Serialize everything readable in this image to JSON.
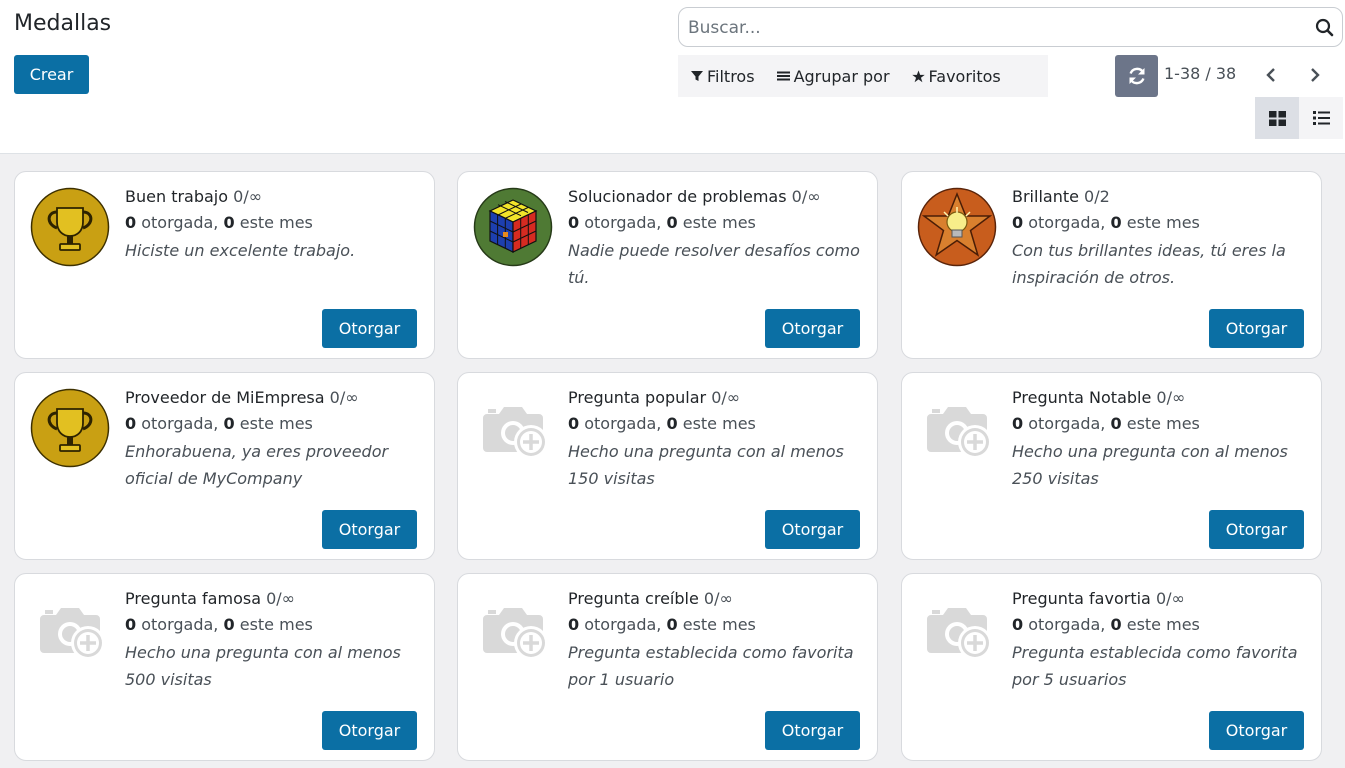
{
  "page": {
    "title": "Medallas",
    "create_label": "Crear"
  },
  "search": {
    "placeholder": "Buscar..."
  },
  "filters": {
    "filters_label": "Filtros",
    "group_by_label": "Agrupar por",
    "favorites_label": "Favoritos"
  },
  "pager": {
    "value": "1-38 / 38"
  },
  "colors": {
    "primary": "#0b6fa4",
    "reload": "#6c7589",
    "background": "#f0f0f2"
  },
  "badges": [
    {
      "name": "Buen trabajo",
      "limit": "0/∞",
      "granted": "0",
      "granted_label": "otorgada,",
      "month": "0",
      "month_label": "este mes",
      "description": "Hiciste un excelente trabajo.",
      "image": "trophy-icon",
      "button": "Otorgar"
    },
    {
      "name": "Solucionador de problemas",
      "limit": "0/∞",
      "granted": "0",
      "granted_label": "otorgada,",
      "month": "0",
      "month_label": "este mes",
      "description": "Nadie puede resolver desafíos como tú.",
      "image": "rubik-cube-icon",
      "button": "Otorgar"
    },
    {
      "name": "Brillante",
      "limit": "0/2",
      "granted": "0",
      "granted_label": "otorgada,",
      "month": "0",
      "month_label": "este mes",
      "description": "Con tus brillantes ideas, tú eres la inspiración de otros.",
      "image": "lightbulb-star-icon",
      "button": "Otorgar"
    },
    {
      "name": "Proveedor de MiEmpresa",
      "limit": "0/∞",
      "granted": "0",
      "granted_label": "otorgada,",
      "month": "0",
      "month_label": "este mes",
      "description": "Enhorabuena, ya eres proveedor oficial de MyCompany",
      "image": "trophy-icon",
      "button": "Otorgar"
    },
    {
      "name": "Pregunta popular",
      "limit": "0/∞",
      "granted": "0",
      "granted_label": "otorgada,",
      "month": "0",
      "month_label": "este mes",
      "description": "Hecho una pregunta con al menos 150 visitas",
      "image": "camera-placeholder-icon",
      "button": "Otorgar"
    },
    {
      "name": "Pregunta Notable",
      "limit": "0/∞",
      "granted": "0",
      "granted_label": "otorgada,",
      "month": "0",
      "month_label": "este mes",
      "description": "Hecho una pregunta con al menos 250 visitas",
      "image": "camera-placeholder-icon",
      "button": "Otorgar"
    },
    {
      "name": "Pregunta famosa",
      "limit": "0/∞",
      "granted": "0",
      "granted_label": "otorgada,",
      "month": "0",
      "month_label": "este mes",
      "description": "Hecho una pregunta con al menos 500 visitas",
      "image": "camera-placeholder-icon",
      "button": "Otorgar"
    },
    {
      "name": "Pregunta creíble",
      "limit": "0/∞",
      "granted": "0",
      "granted_label": "otorgada,",
      "month": "0",
      "month_label": "este mes",
      "description": "Pregunta establecida como favorita por 1 usuario",
      "image": "camera-placeholder-icon",
      "button": "Otorgar"
    },
    {
      "name": "Pregunta favortia",
      "limit": "0/∞",
      "granted": "0",
      "granted_label": "otorgada,",
      "month": "0",
      "month_label": "este mes",
      "description": "Pregunta establecida como favorita por 5 usuarios",
      "image": "camera-placeholder-icon",
      "button": "Otorgar"
    }
  ]
}
